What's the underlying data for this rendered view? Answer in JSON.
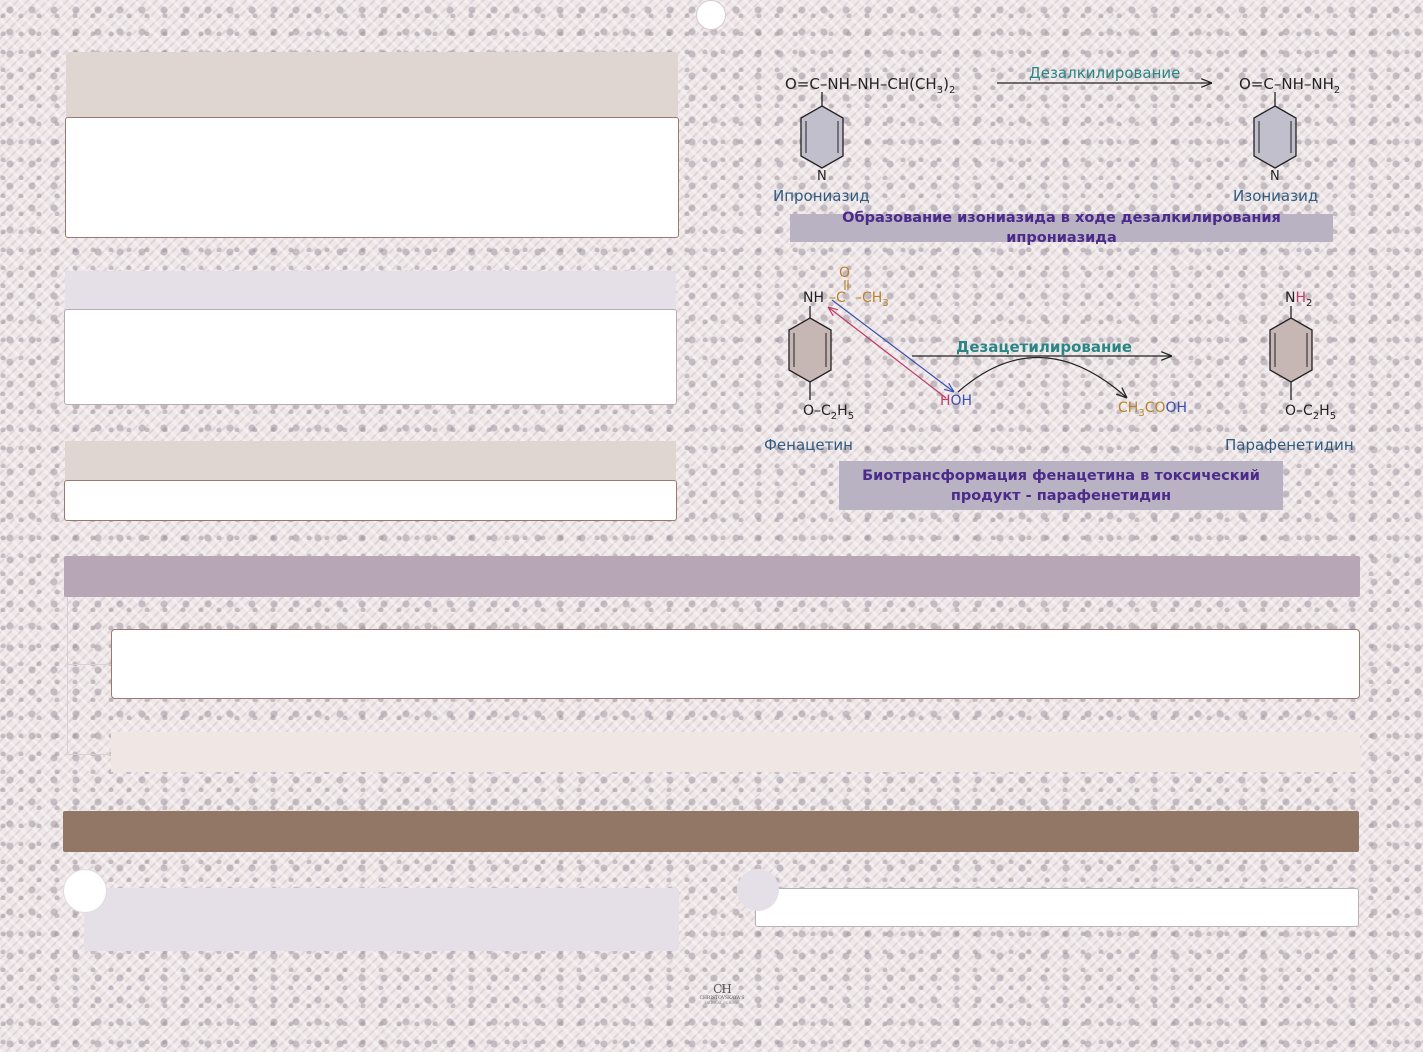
{
  "reaction1": {
    "left_formula_main": "O=C–NH–NH–CH(CH",
    "left_formula_sub3": "3",
    "left_formula_close": ")",
    "left_formula_sub2": "2",
    "arrow_label": "Дезалкилирование",
    "right_formula_main": "O=C–NH–NH",
    "right_formula_sub2": "2",
    "ring_n_left": "N",
    "ring_n_right": "N",
    "left_name": "Ипрониазид",
    "right_name": "Изониазид",
    "caption": "Образование изониазида в ходе дезалкилирования ипрониазида"
  },
  "reaction2": {
    "nh_left": "NH",
    "carbonyl_o": "O",
    "carbonyl_c": "–C",
    "methyl": "–CH",
    "methyl_sub": "3",
    "arrow_label": "Дезацетилирование",
    "water_h": "H",
    "water_oh": "OH",
    "acid_ch": "CH",
    "acid_sub": "3",
    "acid_co": "CO",
    "acid_oh": "OH",
    "left_sub_main": "O–C",
    "left_sub_2": "2",
    "left_sub_h": "H",
    "left_sub_5": "5",
    "right_n": "N",
    "right_h": "H",
    "right_h_sub": "2",
    "right_sub_main": "O–C",
    "right_sub_2": "2",
    "right_sub_h": "H",
    "right_sub_5": "5",
    "left_name": "Фенацетин",
    "right_name": "Парафенетидин",
    "caption_line1": "Биотрансформация фенацетина в токсический",
    "caption_line2": "продукт - парафенетидин"
  },
  "logo": {
    "monogram": "CH",
    "line1": "CHRISTOVSKAYA'S",
    "line2": "MEDICAL SCHOOL"
  },
  "colors": {
    "header_beige": "#dfd6d2",
    "header_lavender": "#e5e0e7",
    "bar_mauve": "#b7a7b6",
    "bar_brown": "#927766",
    "panel_pink": "#f0e6e4",
    "caption_bg": "#b9b2c2",
    "caption_text": "#4b2a8a",
    "teal": "#2a8585",
    "label_blue": "#2f5a7e",
    "orange": "#b8842a",
    "magenta": "#c03a6a",
    "arrow_blue": "#3a4fb0"
  }
}
